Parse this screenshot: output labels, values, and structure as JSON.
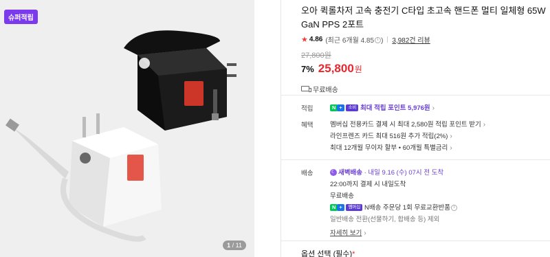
{
  "gallery": {
    "badge": "슈퍼적립",
    "counter_current": "1",
    "counter_total": "/ 11"
  },
  "product": {
    "title": "오아 퀵롤차저 고속 충전기 C타입 초고속 핸드폰 멀티 일체형 65W GaN PPS 2포트",
    "rating": "4.86",
    "rating_detail": "(최근 6개월 4.85",
    "rating_detail_close": ")",
    "review_count": "3,982건 리뷰",
    "original_price": "27,800원",
    "discount": "7%",
    "price": "25,800",
    "price_unit": "원",
    "shipping_summary": "무료배송"
  },
  "points": {
    "label": "적립",
    "npay_label": "N",
    "plus_label": "+",
    "membership_label": "소비",
    "text": "최대 적립 포인트 5,976원"
  },
  "benefits": {
    "label": "혜택",
    "items": [
      "멤버십 전용카드 결제 시 최대 2,580원 적립 포인트 받기",
      "라인프렌즈 카드 최대 516원 추가 적립(2%)",
      "최대 12개월 무이자 할부 • 60개월 특별금리"
    ]
  },
  "delivery": {
    "label": "배송",
    "type_label": "새벽배송",
    "arrival": "· 내일 9.16 (수) 07시 전 도착",
    "cutoff": "22:00까지 결제 시 내일도착",
    "fee": "무료배송",
    "npay_label": "N",
    "plus_label": "+",
    "membership_label": "멤버십",
    "exchange": "N배송 주문당 1회 무료교환반품",
    "exception": "일반배송 전환(선물하기, 합배송 등) 제외",
    "details_link": "자세히 보기"
  },
  "option": {
    "label": "옵션 선택 (필수)",
    "required_mark": "*"
  },
  "colors": {
    "accent_red": "#e8262d",
    "purple": "#6b3fd4",
    "npay_green": "#03c75a"
  }
}
